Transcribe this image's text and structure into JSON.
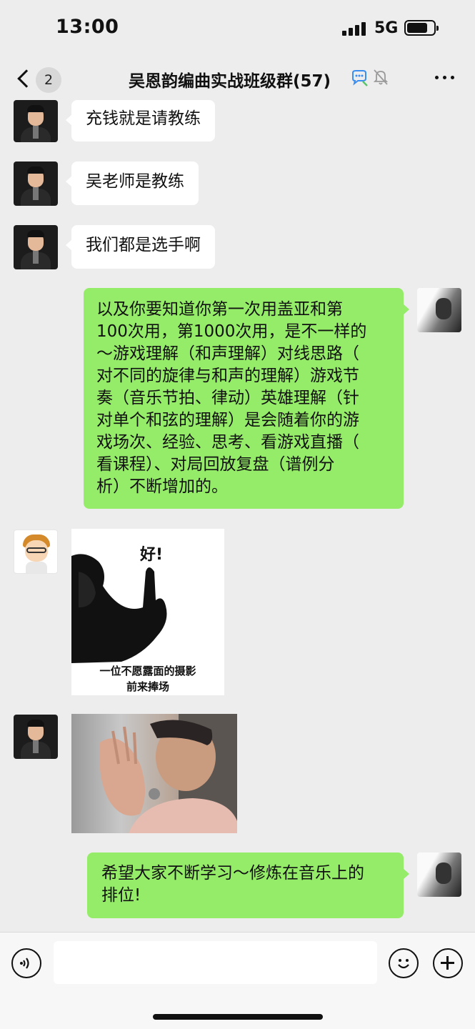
{
  "status_bar": {
    "time": "13:00",
    "network": "5G"
  },
  "header": {
    "back_badge": "2",
    "title": "吴恩韵编曲实战班级群(57)"
  },
  "messages": [
    {
      "sender": "teacher",
      "type": "text",
      "text": "充钱就是请教练"
    },
    {
      "sender": "teacher",
      "type": "text",
      "text": "吴老师是教练"
    },
    {
      "sender": "teacher",
      "type": "text",
      "text": "我们都是选手啊"
    },
    {
      "sender": "self",
      "type": "text",
      "lines": [
        "以及你要知道你第一次用盖亚和第",
        "100次用，第1000次用，是不一样的",
        "～游戏理解（和声理解）对线思路（",
        "对不同的旋律与和声的理解）游戏节",
        "奏（音乐节拍、律动）英雄理解（针",
        "对单个和弦的理解）是会随着你的游",
        "戏场次、经验、思考、看游戏直播（",
        "看课程）、对局回放复盘（谱例分",
        "析）不断增加的。"
      ]
    },
    {
      "sender": "cartoon",
      "type": "sticker",
      "sticker_text": "好!",
      "caption_lines": [
        "一位不愿露面的摄影",
        "前来捧场"
      ]
    },
    {
      "sender": "teacher",
      "type": "sticker",
      "sticker": "clapping-man"
    },
    {
      "sender": "self",
      "type": "text",
      "lines": [
        "希望大家不断学习～修炼在音乐上的",
        "排位!"
      ]
    }
  ],
  "input_bar": {
    "placeholder": ""
  },
  "colors": {
    "background": "#ededed",
    "self_bubble": "#95ec69",
    "other_bubble": "#ffffff"
  },
  "icons": [
    "signal-icon",
    "battery-icon",
    "back-icon",
    "chat-icon",
    "mute-icon",
    "more-icon",
    "voice-icon",
    "emoji-icon",
    "plus-icon"
  ]
}
